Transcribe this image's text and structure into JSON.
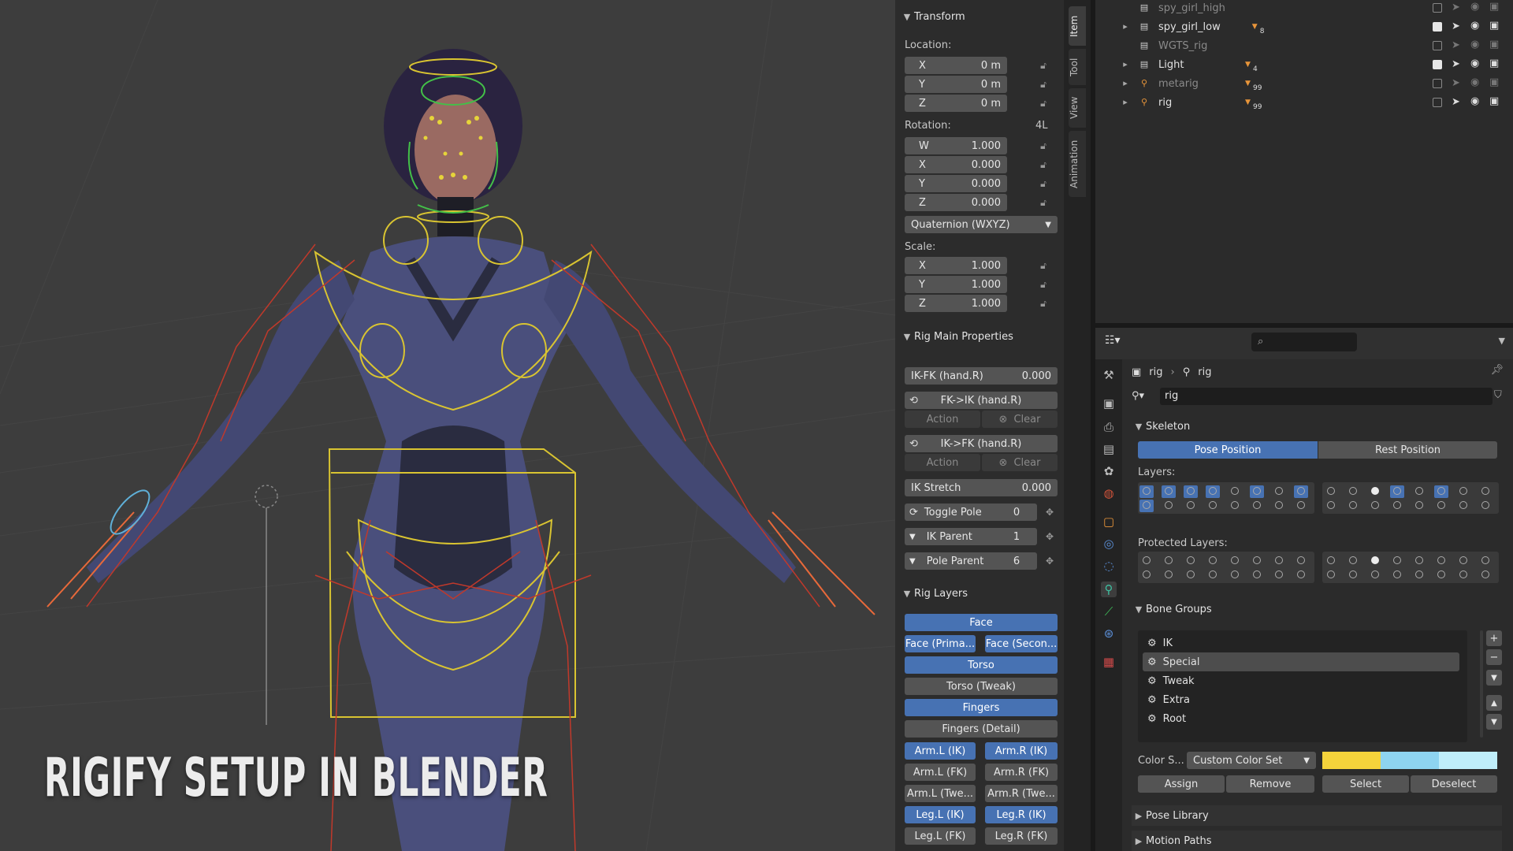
{
  "overlay_title": "RIGIFY SETUP IN BLENDER",
  "npanel": {
    "side_tabs": [
      "Item",
      "Tool",
      "View",
      "Animation"
    ],
    "transform": {
      "title": "Transform",
      "location_label": "Location:",
      "location": [
        {
          "axis": "X",
          "value": "0 m"
        },
        {
          "axis": "Y",
          "value": "0 m"
        },
        {
          "axis": "Z",
          "value": "0 m"
        }
      ],
      "rotation_label": "Rotation:",
      "rotation_mode_badge": "4L",
      "rotation": [
        {
          "axis": "W",
          "value": "1.000"
        },
        {
          "axis": "X",
          "value": "0.000"
        },
        {
          "axis": "Y",
          "value": "0.000"
        },
        {
          "axis": "Z",
          "value": "0.000"
        }
      ],
      "rotation_mode": "Quaternion (WXYZ)",
      "scale_label": "Scale:",
      "scale": [
        {
          "axis": "X",
          "value": "1.000"
        },
        {
          "axis": "Y",
          "value": "1.000"
        },
        {
          "axis": "Z",
          "value": "1.000"
        }
      ]
    },
    "rig_main": {
      "title": "Rig Main Properties",
      "ikfk_label": "IK-FK (hand.R)",
      "ikfk_value": "0.000",
      "fk_ik_label": "FK->IK (hand.R)",
      "ik_fk_label": "IK->FK (hand.R)",
      "action_label": "Action",
      "clear_label": "Clear",
      "ik_stretch_label": "IK Stretch",
      "ik_stretch_value": "0.000",
      "toggle_pole_label": "Toggle Pole",
      "toggle_pole_value": "0",
      "ik_parent_label": "IK Parent",
      "ik_parent_value": "1",
      "pole_parent_label": "Pole Parent",
      "pole_parent_value": "6"
    },
    "rig_layers": {
      "title": "Rig Layers",
      "face": "Face",
      "face_primary": "Face (Prima...",
      "face_secondary": "Face (Secon...",
      "torso": "Torso",
      "torso_tweak": "Torso (Tweak)",
      "fingers": "Fingers",
      "fingers_detail": "Fingers (Detail)",
      "arm_l_ik": "Arm.L (IK)",
      "arm_r_ik": "Arm.R (IK)",
      "arm_l_fk": "Arm.L (FK)",
      "arm_r_fk": "Arm.R (FK)",
      "arm_l_tweak": "Arm.L (Twe...",
      "arm_r_tweak": "Arm.R (Twe...",
      "leg_l_ik": "Leg.L (IK)",
      "leg_r_ik": "Leg.R (IK)",
      "leg_l_fk": "Leg.L (FK)",
      "leg_r_fk": "Leg.R (FK)"
    }
  },
  "outliner": {
    "rows": [
      {
        "name": "spy_girl_high",
        "dim": true,
        "badge": ""
      },
      {
        "name": "spy_girl_low",
        "dim": false,
        "badge": "8"
      },
      {
        "name": "WGTS_rig",
        "dim": true,
        "badge": ""
      },
      {
        "name": "Light",
        "dim": false,
        "badge": "4"
      },
      {
        "name": "metarig",
        "dim": true,
        "badge": "99"
      },
      {
        "name": "rig",
        "dim": false,
        "badge": "99"
      }
    ]
  },
  "properties": {
    "breadcrumb_a": "rig",
    "breadcrumb_b": "rig",
    "armature_name": "rig",
    "skeleton": {
      "title": "Skeleton",
      "pose_position": "Pose Position",
      "rest_position": "Rest Position",
      "layers_label": "Layers:",
      "protected_label": "Protected Layers:"
    },
    "bone_groups": {
      "title": "Bone Groups",
      "items": [
        "IK",
        "Special",
        "Tweak",
        "Extra",
        "Root"
      ],
      "selected_index": 1,
      "color_set_label": "Color S...",
      "color_set_value": "Custom Color Set",
      "swatches": [
        "#f5d33b",
        "#8ed4f0",
        "#bfeefa"
      ],
      "assign": "Assign",
      "remove": "Remove",
      "select": "Select",
      "deselect": "Deselect"
    },
    "pose_library": "Pose Library",
    "motion_paths": "Motion Paths"
  },
  "colors": {
    "accent": "#4772b3",
    "rig_yellow": "#d9c431",
    "rig_red": "#c0392b"
  }
}
